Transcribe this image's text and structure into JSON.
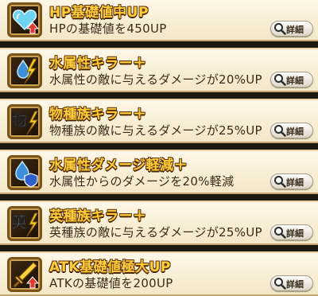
{
  "abilities": [
    {
      "icon": "heart-up-icon",
      "title": "HP基礎値中UP",
      "description": "HPの基礎値を450UP",
      "detail_label": "詳細"
    },
    {
      "icon": "water-killer-icon",
      "title": "水属性キラー＋",
      "description": "水属性の敵に与えるダメージが20%UP",
      "detail_label": "詳細"
    },
    {
      "icon": "matter-race-killer-icon",
      "icon_glyph": "物",
      "title": "物種族キラー＋",
      "description": "物種族の敵に与えるダメージが25%UP",
      "detail_label": "詳細"
    },
    {
      "icon": "water-resist-shield-icon",
      "title": "水属性ダメージ軽減＋",
      "description": "水属性からのダメージを20%軽減",
      "detail_label": "詳細"
    },
    {
      "icon": "hero-race-killer-icon",
      "icon_glyph": "英",
      "title": "英種族キラー＋",
      "description": "英種族の敵に与えるダメージが25%UP",
      "detail_label": "詳細"
    },
    {
      "icon": "sword-up-icon",
      "title": "ATK基礎値極大UP",
      "description": "ATKの基礎値を200UP",
      "detail_label": "詳細"
    }
  ],
  "colors": {
    "title": "#ffce3a",
    "title_outline": "#5b2f07",
    "description": "#3c2a1a",
    "row_background": "#f7ecd2",
    "icon_frame": "#7a5418"
  }
}
